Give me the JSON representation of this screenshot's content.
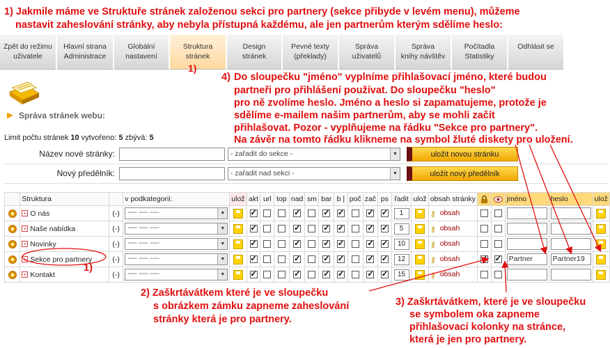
{
  "annotations": {
    "top_line1": "1)  Jakmile máme ve Struktuře stránek založenou sekci pro partnery (sekce přibyde v levém menu), můžeme",
    "top_line2": "nastavit zaheslování stránky, aby nebyla přístupná každému, ale jen  partnerům kterým sdělíme heslo:",
    "tab_marker": "1)",
    "note4_l1": "Do sloupečku \"jméno\" vyplníme přihlašovací  jméno, které budou",
    "note4_l2": "partneři pro přihlášení používat. Do sloupečku \"heslo\"",
    "note4_l3": "pro ně zvolíme heslo. Jméno a heslo si zapamatujeme, protože je",
    "note4_l4": "sdělíme e-mailem našim partnerům, aby se mohli začít",
    "note4_l5": "přihlašovat. Pozor - vyplňujeme na řádku \"Sekce pro partnery\".",
    "note4_l6": "Na závěr na tomto řádku klikneme na symbol žluté diskety pro uložení.",
    "note4_num": "4)",
    "row_marker": "1)",
    "note2_l1": "2) Zaškrtávátkem které je ve sloupečku",
    "note2_l2": "s obrázkem zámku zapneme zaheslování",
    "note2_l3": "stránky která je pro partnery.",
    "note3_l1": "3) Zaškrtávátkem, které je ve sloupečku",
    "note3_l2": "se symbolem oka zapneme",
    "note3_l3": "přihlašovací kolonky na stránce,",
    "note3_l4": "která je jen pro partnery."
  },
  "nav": {
    "tabs": [
      {
        "label": "Zpět do režimu\nuživatele",
        "name": "tab-back-user-mode"
      },
      {
        "label": "Hlavní strana\nAdministrace",
        "name": "tab-admin-home"
      },
      {
        "label": "Globální\nnastavení",
        "name": "tab-global-settings"
      },
      {
        "label": "Struktura\nstránek",
        "name": "tab-page-structure"
      },
      {
        "label": "Design\nstránek",
        "name": "tab-page-design"
      },
      {
        "label": "Pevné texty\n(překlady)",
        "name": "tab-fixed-texts"
      },
      {
        "label": "Správa\nuživatelů",
        "name": "tab-user-management"
      },
      {
        "label": "Správa\nknihy návštěv",
        "name": "tab-guestbook"
      },
      {
        "label": "Počítadla\nStatistiky",
        "name": "tab-counters-stats"
      },
      {
        "label": "Odhlásit se",
        "name": "tab-logout"
      }
    ]
  },
  "header": {
    "section_title": "Správa stránek webu:",
    "limit_prefix": "Limit počtu stránek ",
    "limit_value": "10",
    "created_prefix": " vytvořeno: ",
    "created_value": "5",
    "remaining_prefix": " zbývá: ",
    "remaining_value": "5"
  },
  "forms": {
    "new_page_label": "Název nové stránky:",
    "new_page_select": "- zařadit do sekce -",
    "new_page_button": "uložit novou stránku",
    "new_divider_label": "Nový předělník:",
    "new_divider_select": "- zařadit nad sekci -",
    "new_divider_button": "uložit nový předělník"
  },
  "table": {
    "headers": {
      "structure": "Struktura",
      "subcategory": "v podkategorii:",
      "save": "ulož",
      "active": "akt",
      "url": "url",
      "top": "top",
      "above": "nad",
      "sm": "sm",
      "bar": "bar",
      "b": "b |",
      "counter": "poč",
      "start": "zač",
      "ps": "ps",
      "order": "řadit",
      "save2": "ulož",
      "content": "obsah stránky",
      "name": "jméno",
      "password": "heslo",
      "save3": "ulož"
    },
    "sub_select_value": "---- ---- ----",
    "content_link": "obsah",
    "rows": [
      {
        "name": "O nás",
        "dash": "(-)",
        "order": "1",
        "login": "",
        "password": ""
      },
      {
        "name": "Naše nabídka",
        "dash": "(-)",
        "order": "5",
        "login": "",
        "password": ""
      },
      {
        "name": "Novinky",
        "dash": "(-)",
        "order": "10",
        "login": "",
        "password": ""
      },
      {
        "name": "Sekce pro partnery",
        "dash": "(-)",
        "order": "12",
        "login": "Partner",
        "password": "Partner19"
      },
      {
        "name": "Kontakt",
        "dash": "(-)",
        "order": "15",
        "login": "",
        "password": ""
      }
    ]
  },
  "colors": {
    "annotation": "#e01010",
    "accent": "#f0a800",
    "button_edge": "#6b1010"
  }
}
